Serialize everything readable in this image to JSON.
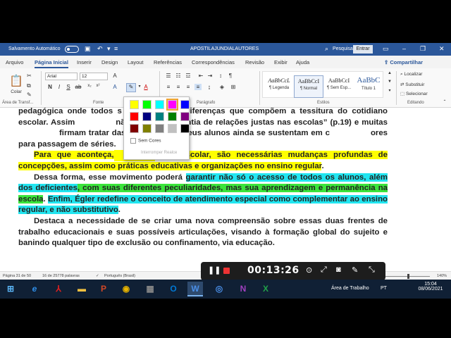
{
  "titlebar": {
    "autosave_label": "Salvamento Automático",
    "doc_title": "APOSTILAJUNDIALAUTORES",
    "search_label": "Pesquisa",
    "signin_label": "Entrar",
    "bg_color": "#2b579a"
  },
  "tabs": [
    "Arquivo",
    "Página Inicial",
    "Inserir",
    "Design",
    "Layout",
    "Referências",
    "Correspondências",
    "Revisão",
    "Exibir",
    "Ajuda"
  ],
  "share_label": "Compartilhar",
  "ribbon": {
    "paste_label": "Colar",
    "clipboard_group": "Área de Transf...",
    "font_name": "Arial",
    "font_size": "12",
    "font_group": "Fonte",
    "paragraph_group": "Parágrafo",
    "styles_group": "Estilos",
    "editing_group": "Editando",
    "styles": [
      {
        "sample": "AaBbCcL",
        "name": "¶ Legenda"
      },
      {
        "sample": "AaBbCcI",
        "name": "¶ Normal"
      },
      {
        "sample": "AaBbCcI",
        "name": "¶ Sem Esp..."
      },
      {
        "sample": "AaBbC",
        "name": "Título 1"
      }
    ],
    "find_label": "Localizar",
    "replace_label": "Substituir",
    "select_label": "Selecionar"
  },
  "highlight_menu": {
    "colors": [
      "#ffff00",
      "#00ff00",
      "#00ffff",
      "#ff00ff",
      "#0000ff",
      "#ff0000",
      "#000080",
      "#008080",
      "#008000",
      "#800080",
      "#800000",
      "#808000",
      "#808080",
      "#c0c0c0",
      "#000000"
    ],
    "no_color_label": "Sem Cores",
    "stop_label": "Interromper Realce"
  },
  "document": {
    "p1a": "pedagógica onde todos s",
    "p1b": "a as diferenças que compõem a tessitura do cotidiano escolar. Assim",
    "p1c": "não gerou a “garantia de relações justas nas escolas” (p.19) e muitas",
    "p1d": "firmam tratar das diferenças de seus alunos ainda se sustentam em c",
    "p1e": "ores para passagem de séries.",
    "p2a": "Para que aconteça,",
    "p2b": "lusão escolar, são necessárias mudanças profundas de concepções, assim como práticas educativas e organizações no ensino regular",
    "p2c": ".",
    "p3a": "Dessa forma, esse movimento poderá",
    "p3b": "garantir não só o acesso de todos os alunos, além dos deficientes",
    "p3c": ", com suas diferentes peculiaridades, mas sua aprendizagem e permanência na escola",
    "p3d": ". ",
    "p3e": "Enfim, Égler redefine o conceito de atendimento especial como complementar ao ensino regular, e não substitutivo",
    "p3f": ".",
    "p4": "Destaca a necessidade de se criar uma nova compreensão sobre essas duas frentes de trabalho educacionais e suas possíveis articulações, visando à formação global do sujeito e banindo qualquer tipo de exclusão ou confinamento, via educação."
  },
  "status": {
    "page": "Página 31 de 50",
    "words": "16 de 25778 palavras",
    "language": "Português (Brasil)",
    "zoom": "140%"
  },
  "recorder": {
    "time": "00:13:26"
  },
  "taskbar": {
    "desktop_label": "Área de Trabalho",
    "lang": "PT",
    "time": "15:04",
    "date": "08/06/2021"
  }
}
